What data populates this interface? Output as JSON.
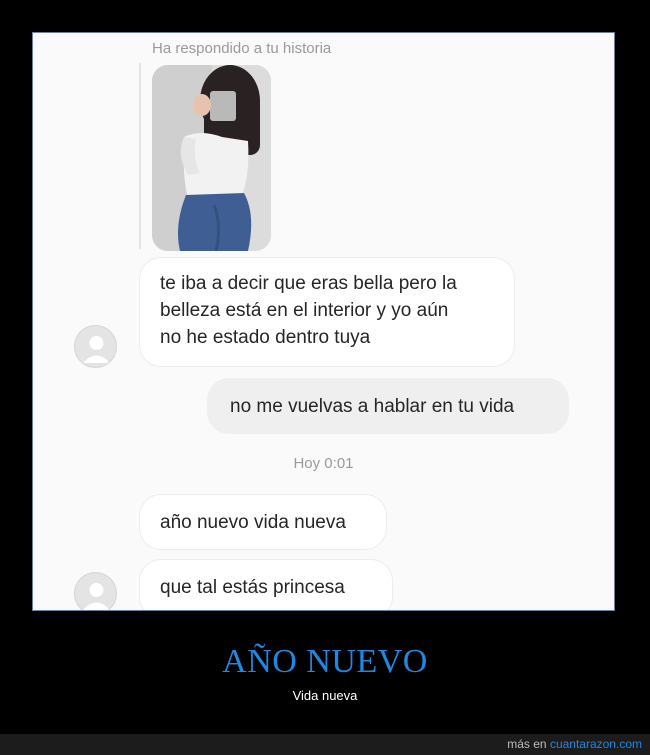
{
  "screenshot": {
    "story_reply_label": "Ha respondido a tu historia",
    "messages": [
      {
        "direction": "in",
        "lines": [
          "te iba a decir que eras bella pero la",
          "belleza está en el interior y yo aún",
          "no he estado dentro tuya"
        ]
      },
      {
        "direction": "out",
        "lines": [
          "no me vuelvas a hablar en tu vida"
        ]
      },
      {
        "direction": "in",
        "lines": [
          "año nuevo vida nueva"
        ]
      },
      {
        "direction": "in",
        "lines": [
          "que tal estás princesa"
        ]
      }
    ],
    "timestamp": "Hoy 0:01"
  },
  "caption": {
    "title": "AÑO NUEVO",
    "subtitle": "Vida nueva"
  },
  "footer": {
    "prefix": "más en",
    "site": "cuantarazon.com"
  },
  "colors": {
    "accent": "#1e88e5",
    "frame_border": "#6d7ea1",
    "incoming_bubble": "#ffffff",
    "outgoing_bubble": "#efefef"
  },
  "icons": [
    "default-avatar-icon"
  ]
}
